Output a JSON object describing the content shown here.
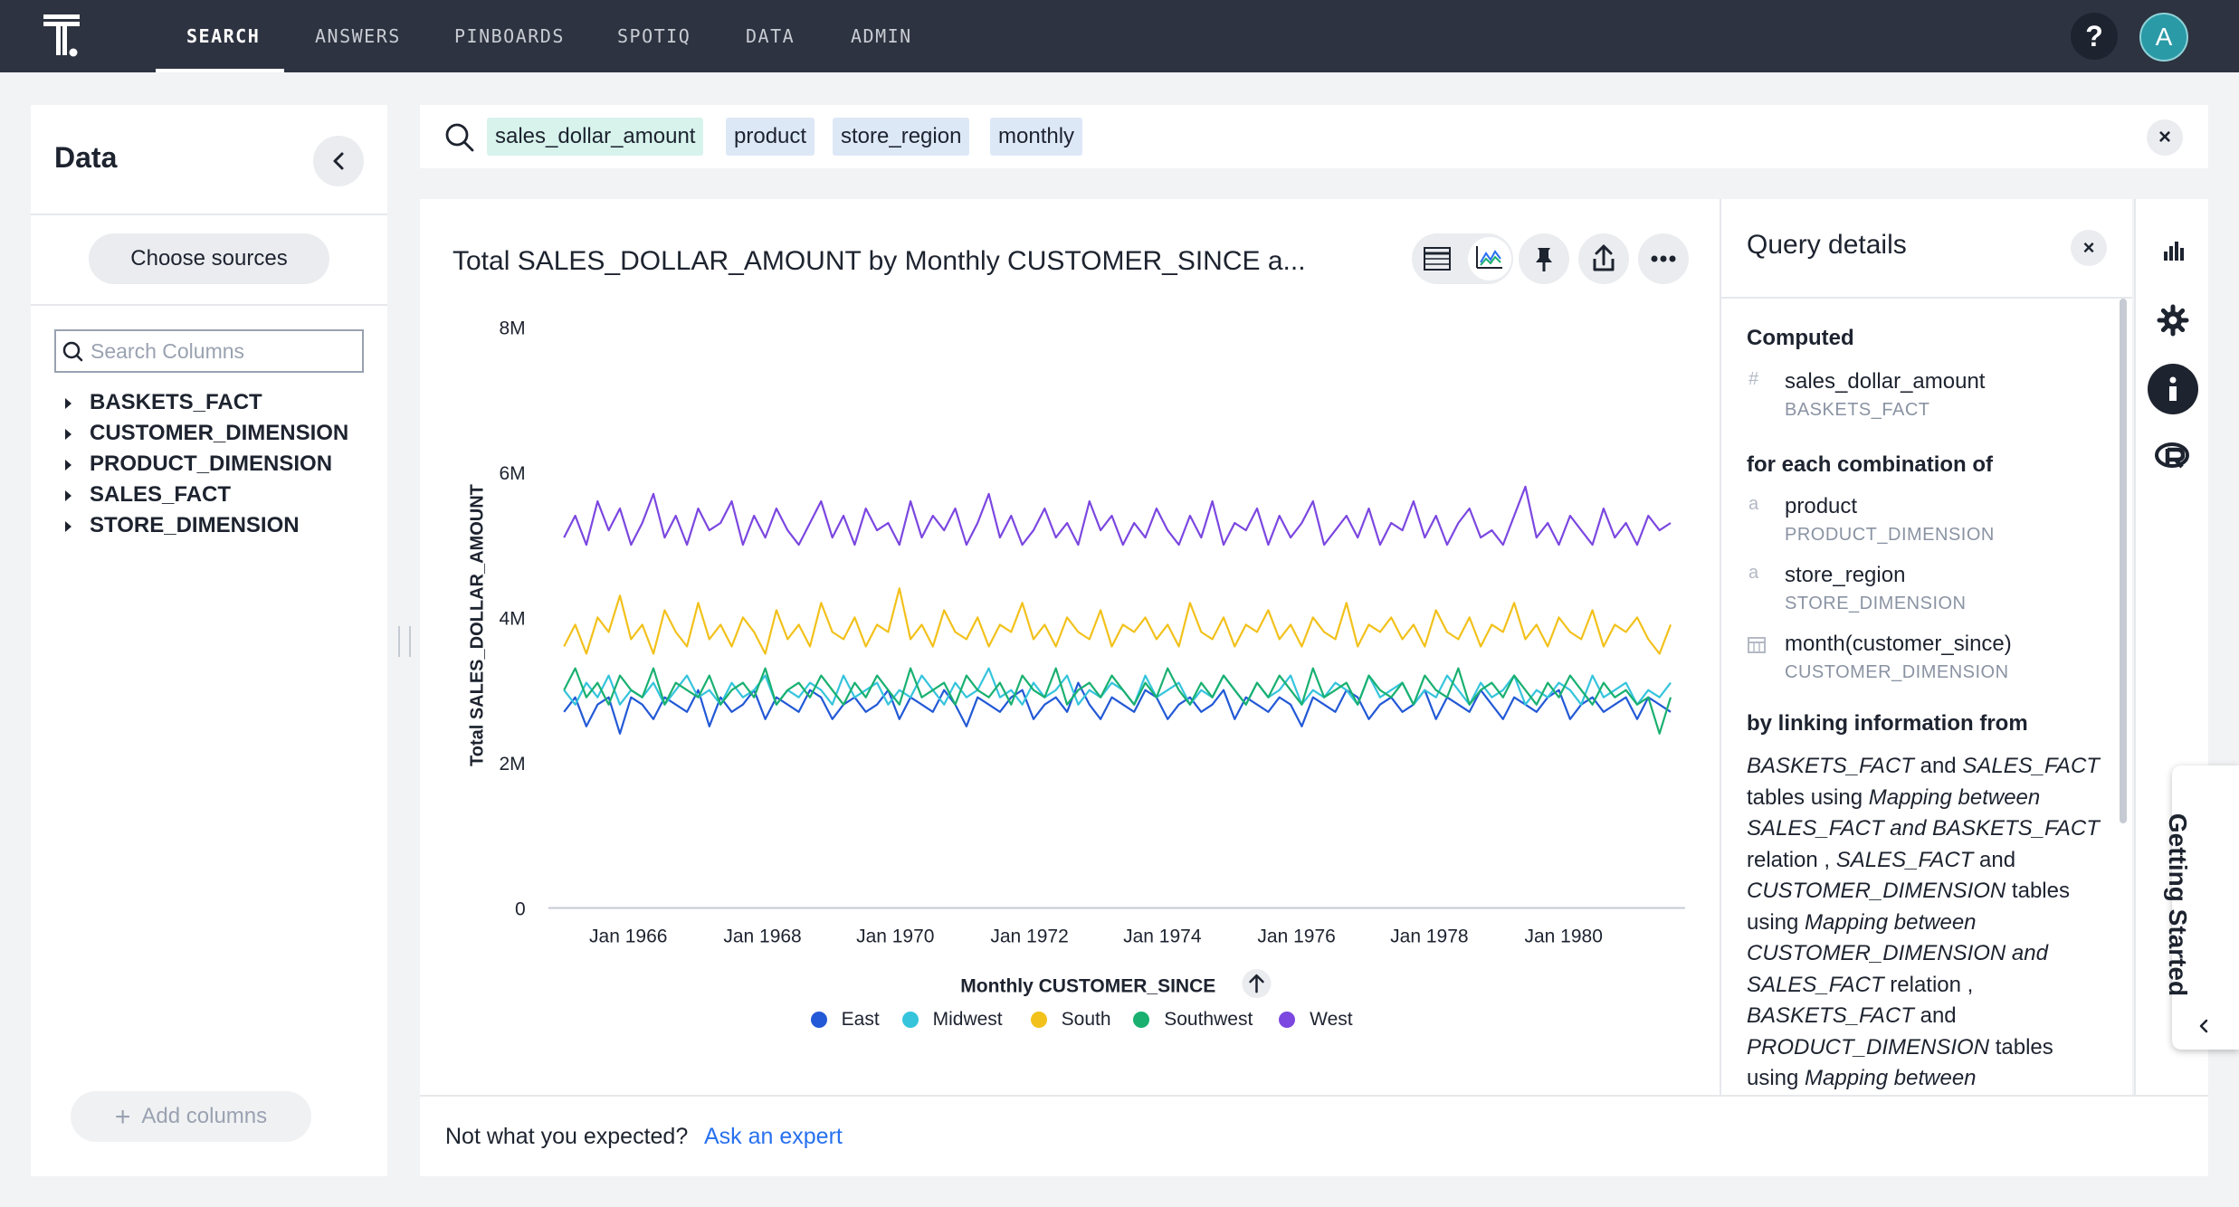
{
  "nav": {
    "items": [
      "SEARCH",
      "ANSWERS",
      "PINBOARDS",
      "SPOTIQ",
      "DATA",
      "ADMIN"
    ],
    "active": "SEARCH",
    "help_label": "?",
    "avatar_initial": "A"
  },
  "data_panel": {
    "title": "Data",
    "choose_sources": "Choose sources",
    "search_placeholder": "Search Columns",
    "sources": [
      "BASKETS_FACT",
      "CUSTOMER_DIMENSION",
      "PRODUCT_DIMENSION",
      "SALES_FACT",
      "STORE_DIMENSION"
    ],
    "add_columns": "Add columns"
  },
  "search": {
    "tokens": [
      "sales_dollar_amount",
      "product",
      "store_region",
      "monthly"
    ],
    "clear_label": "×"
  },
  "answer": {
    "title": "Total SALES_DOLLAR_AMOUNT by Monthly CUSTOMER_SINCE a...",
    "toolbar_icons": [
      "table-icon",
      "chart-icon",
      "pin-icon",
      "share-icon",
      "more-icon"
    ]
  },
  "chart_data": {
    "type": "line",
    "xlabel": "Monthly CUSTOMER_SINCE",
    "ylabel": "Total SALES_DOLLAR_AMOUNT",
    "ylim": [
      0,
      8000000
    ],
    "y_ticks": [
      "0",
      "2M",
      "4M",
      "6M",
      "8M"
    ],
    "x_ticks": [
      "Jan 1966",
      "Jan 1968",
      "Jan 1970",
      "Jan 1972",
      "Jan 1974",
      "Jan 1976",
      "Jan 1978",
      "Jan 1980"
    ],
    "x_range": [
      "Jan 1965",
      "Jun 1981"
    ],
    "sort_indicator": "ascending",
    "legend_position": "bottom",
    "series": [
      {
        "name": "East",
        "color": "#2359d6",
        "values": [
          2.7,
          2.9,
          2.5,
          2.8,
          2.9,
          2.4,
          2.9,
          2.8,
          2.6,
          2.9,
          2.8,
          2.7,
          3.0,
          2.5,
          2.9,
          2.7,
          2.8,
          3.0,
          2.6,
          2.9,
          2.8,
          2.7,
          3.0,
          2.9,
          2.6,
          2.8,
          2.9,
          2.7,
          2.8,
          3.0,
          2.6,
          2.9,
          2.8,
          2.7,
          3.0,
          2.8,
          2.5,
          2.9,
          2.8,
          2.7,
          2.9,
          3.0,
          2.6,
          2.8,
          2.9,
          2.7,
          3.1,
          2.8,
          2.6,
          2.9,
          2.8,
          2.7,
          3.0,
          2.9,
          2.6,
          2.8,
          2.9,
          2.7,
          2.8,
          3.0,
          2.6,
          2.9,
          2.8,
          2.7,
          2.9,
          2.8,
          2.5,
          2.9,
          2.8,
          2.7,
          3.0,
          2.9,
          2.6,
          2.8,
          2.9,
          2.7,
          2.8,
          3.0,
          2.6,
          2.9,
          2.8,
          2.7,
          3.0,
          2.8,
          2.6,
          2.9,
          2.8,
          2.7,
          2.9,
          3.0,
          2.6,
          2.8,
          2.9,
          2.7,
          2.8,
          2.9,
          2.6,
          2.9,
          2.8,
          2.7
        ]
      },
      {
        "name": "Midwest",
        "color": "#35c4dc",
        "values": [
          3.0,
          2.8,
          3.1,
          2.9,
          3.2,
          2.8,
          3.0,
          2.9,
          3.1,
          2.8,
          3.0,
          3.2,
          2.9,
          3.0,
          2.8,
          3.1,
          2.9,
          3.0,
          3.2,
          2.8,
          3.0,
          2.9,
          3.1,
          3.0,
          2.8,
          3.2,
          2.9,
          3.0,
          3.1,
          2.8,
          3.0,
          2.9,
          3.2,
          3.0,
          2.8,
          3.1,
          2.9,
          3.0,
          3.3,
          2.9,
          3.0,
          2.8,
          3.1,
          2.9,
          3.0,
          3.2,
          2.8,
          3.0,
          2.9,
          3.1,
          3.0,
          2.8,
          3.2,
          2.9,
          3.0,
          3.1,
          2.8,
          3.0,
          2.9,
          3.2,
          3.0,
          2.8,
          3.1,
          2.9,
          3.0,
          3.2,
          2.8,
          3.0,
          2.9,
          3.1,
          3.0,
          2.8,
          3.2,
          2.9,
          3.0,
          3.1,
          2.8,
          3.0,
          2.9,
          3.2,
          3.0,
          2.8,
          3.1,
          2.9,
          3.0,
          3.2,
          2.8,
          3.0,
          2.9,
          3.1,
          3.0,
          2.8,
          3.2,
          2.9,
          3.0,
          3.1,
          2.8,
          3.0,
          2.9,
          3.1
        ]
      },
      {
        "name": "South",
        "color": "#f2c11b",
        "values": [
          3.6,
          3.9,
          3.5,
          4.0,
          3.8,
          4.3,
          3.7,
          3.9,
          3.5,
          4.1,
          3.8,
          3.6,
          4.2,
          3.7,
          3.9,
          3.6,
          4.0,
          3.8,
          3.5,
          4.1,
          3.7,
          3.9,
          3.6,
          4.2,
          3.8,
          3.7,
          4.0,
          3.6,
          3.9,
          3.8,
          4.4,
          3.7,
          3.9,
          3.6,
          4.1,
          3.8,
          3.7,
          4.0,
          3.6,
          3.9,
          3.8,
          4.2,
          3.7,
          3.9,
          3.6,
          4.0,
          3.8,
          3.7,
          4.1,
          3.6,
          3.9,
          3.8,
          4.0,
          3.7,
          3.9,
          3.6,
          4.2,
          3.8,
          3.7,
          4.0,
          3.6,
          3.9,
          3.8,
          4.1,
          3.7,
          3.9,
          3.6,
          4.0,
          3.8,
          3.7,
          4.2,
          3.6,
          3.9,
          3.8,
          4.0,
          3.7,
          3.9,
          3.6,
          4.1,
          3.8,
          3.7,
          4.0,
          3.6,
          3.9,
          3.8,
          4.2,
          3.7,
          3.9,
          3.6,
          4.0,
          3.8,
          3.7,
          4.1,
          3.6,
          3.9,
          3.8,
          4.0,
          3.7,
          3.5,
          3.9
        ]
      },
      {
        "name": "Southwest",
        "color": "#19b070",
        "values": [
          3.0,
          3.3,
          2.9,
          3.1,
          2.8,
          3.2,
          3.0,
          2.9,
          3.3,
          2.8,
          3.1,
          3.0,
          2.9,
          3.2,
          2.8,
          3.0,
          3.1,
          2.9,
          3.3,
          2.8,
          3.0,
          3.1,
          2.9,
          3.2,
          3.0,
          2.8,
          3.1,
          2.9,
          3.2,
          3.0,
          2.8,
          3.3,
          2.9,
          3.0,
          3.1,
          2.8,
          3.2,
          3.0,
          2.9,
          3.1,
          2.8,
          3.2,
          3.0,
          2.9,
          3.3,
          2.8,
          3.0,
          3.1,
          2.9,
          3.2,
          3.0,
          2.8,
          3.1,
          2.9,
          3.3,
          3.0,
          2.8,
          3.1,
          2.9,
          3.2,
          3.0,
          2.8,
          3.1,
          2.9,
          3.2,
          3.0,
          2.8,
          3.3,
          2.9,
          3.0,
          3.1,
          2.8,
          3.2,
          3.0,
          2.9,
          3.1,
          2.8,
          3.2,
          3.0,
          2.9,
          3.3,
          2.8,
          3.0,
          3.1,
          2.9,
          3.2,
          3.0,
          2.8,
          3.1,
          2.9,
          3.2,
          3.0,
          2.8,
          3.1,
          2.9,
          3.0,
          2.8,
          2.9,
          2.4,
          2.9
        ]
      },
      {
        "name": "West",
        "color": "#7b47e0",
        "values": [
          5.1,
          5.4,
          5.0,
          5.6,
          5.2,
          5.5,
          5.0,
          5.3,
          5.7,
          5.1,
          5.4,
          5.0,
          5.5,
          5.2,
          5.3,
          5.6,
          5.0,
          5.4,
          5.1,
          5.5,
          5.2,
          5.0,
          5.3,
          5.6,
          5.1,
          5.4,
          5.0,
          5.5,
          5.2,
          5.3,
          5.0,
          5.6,
          5.1,
          5.4,
          5.2,
          5.5,
          5.0,
          5.3,
          5.7,
          5.1,
          5.4,
          5.0,
          5.2,
          5.5,
          5.1,
          5.3,
          5.0,
          5.6,
          5.2,
          5.4,
          5.0,
          5.3,
          5.1,
          5.5,
          5.2,
          5.0,
          5.4,
          5.1,
          5.6,
          5.0,
          5.3,
          5.2,
          5.5,
          5.0,
          5.4,
          5.1,
          5.3,
          5.6,
          5.0,
          5.2,
          5.4,
          5.1,
          5.5,
          5.0,
          5.3,
          5.2,
          5.6,
          5.1,
          5.4,
          5.0,
          5.3,
          5.5,
          5.1,
          5.2,
          5.0,
          5.4,
          5.8,
          5.1,
          5.3,
          5.0,
          5.4,
          5.2,
          5.0,
          5.5,
          5.1,
          5.3,
          5.0,
          5.4,
          5.2,
          5.3
        ]
      }
    ]
  },
  "footer": {
    "question": "Not what you expected?",
    "link": "Ask an expert"
  },
  "query_details": {
    "title": "Query details",
    "close_label": "×",
    "computed_label": "Computed",
    "computed": [
      {
        "icon": "#",
        "name": "sales_dollar_amount",
        "table": "BASKETS_FACT"
      }
    ],
    "combination_label": "for each combination of",
    "combination": [
      {
        "icon": "a",
        "name": "product",
        "table": "PRODUCT_DIMENSION"
      },
      {
        "icon": "a",
        "name": "store_region",
        "table": "STORE_DIMENSION"
      },
      {
        "icon": "calendar",
        "name": "month(customer_since)",
        "table": "CUSTOMER_DIMENSION"
      }
    ],
    "linking_label": "by linking information from",
    "linking_text": [
      "BASKETS_FACT",
      " and ",
      "SALES_FACT",
      " tables using ",
      "Mapping between SALES_FACT and BASKETS_FACT",
      " relation , ",
      "SALES_FACT",
      " and ",
      "CUSTOMER_DIMENSION",
      " tables using ",
      "Mapping between CUSTOMER_DIMENSION and SALES_FACT",
      " relation , ",
      "BASKETS_FACT",
      " and ",
      "PRODUCT_DIMENSION",
      " tables using ",
      "Mapping between"
    ]
  },
  "right_rail": {
    "icons": [
      "bar-chart-icon",
      "gear-icon",
      "info-icon",
      "r-language-icon"
    ],
    "getting_started": "Getting Started"
  },
  "colors": {
    "topnav": "#2d3340",
    "accent_link": "#2770ef",
    "measure_token": "#d7f3ec",
    "attribute_token": "#dde8f7"
  }
}
